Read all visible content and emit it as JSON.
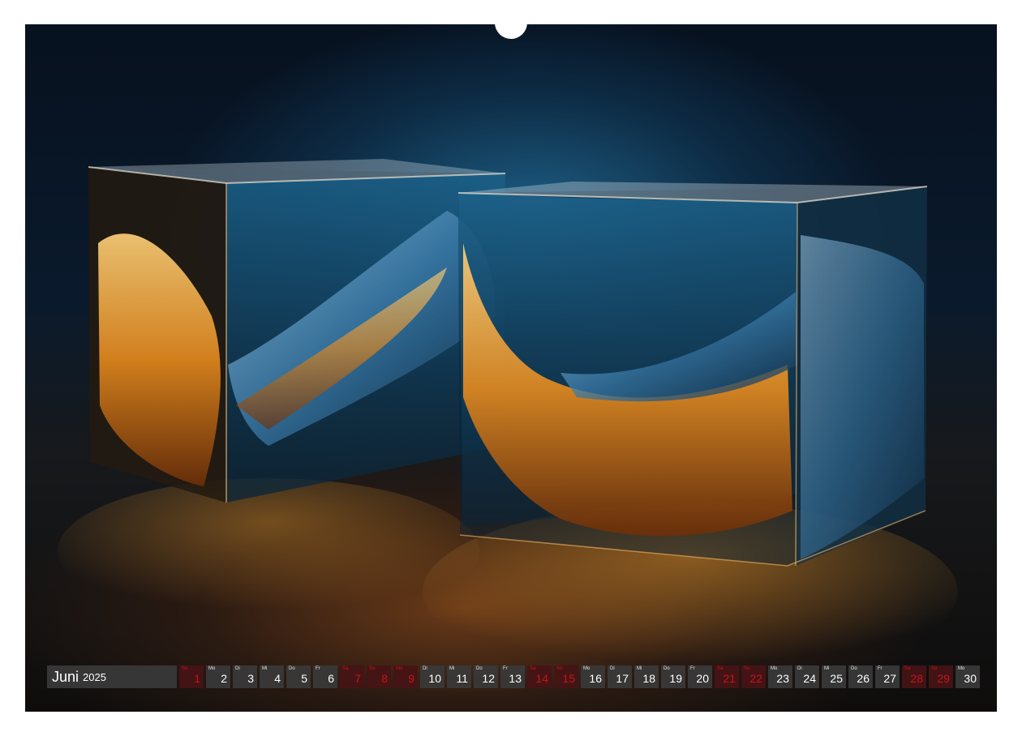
{
  "calendar": {
    "month": "Juni",
    "year": "2025",
    "days": [
      {
        "wd": "So",
        "num": "1",
        "red": true
      },
      {
        "wd": "Mo",
        "num": "2",
        "red": false
      },
      {
        "wd": "Di",
        "num": "3",
        "red": false
      },
      {
        "wd": "Mi",
        "num": "4",
        "red": false
      },
      {
        "wd": "Do",
        "num": "5",
        "red": false
      },
      {
        "wd": "Fr",
        "num": "6",
        "red": false
      },
      {
        "wd": "Sa",
        "num": "7",
        "red": true
      },
      {
        "wd": "So",
        "num": "8",
        "red": true
      },
      {
        "wd": "Mo",
        "num": "9",
        "red": true
      },
      {
        "wd": "Di",
        "num": "10",
        "red": false
      },
      {
        "wd": "Mi",
        "num": "11",
        "red": false
      },
      {
        "wd": "Do",
        "num": "12",
        "red": false
      },
      {
        "wd": "Fr",
        "num": "13",
        "red": false
      },
      {
        "wd": "Sa",
        "num": "14",
        "red": true
      },
      {
        "wd": "So",
        "num": "15",
        "red": true
      },
      {
        "wd": "Mo",
        "num": "16",
        "red": false
      },
      {
        "wd": "Di",
        "num": "17",
        "red": false
      },
      {
        "wd": "Mi",
        "num": "18",
        "red": false
      },
      {
        "wd": "Do",
        "num": "19",
        "red": false
      },
      {
        "wd": "Fr",
        "num": "20",
        "red": false
      },
      {
        "wd": "Sa",
        "num": "21",
        "red": true
      },
      {
        "wd": "So",
        "num": "22",
        "red": true
      },
      {
        "wd": "Mo",
        "num": "23",
        "red": false
      },
      {
        "wd": "Di",
        "num": "24",
        "red": false
      },
      {
        "wd": "Mi",
        "num": "25",
        "red": false
      },
      {
        "wd": "Do",
        "num": "26",
        "red": false
      },
      {
        "wd": "Fr",
        "num": "27",
        "red": false
      },
      {
        "wd": "Sa",
        "num": "28",
        "red": true
      },
      {
        "wd": "So",
        "num": "29",
        "red": true
      },
      {
        "wd": "Mo",
        "num": "30",
        "red": false
      }
    ]
  },
  "colors": {
    "holiday_text": "#c4161c",
    "cell_background": "#3a3a3a",
    "photo_background": "#0a1a2c",
    "glow": "#f0a030"
  }
}
